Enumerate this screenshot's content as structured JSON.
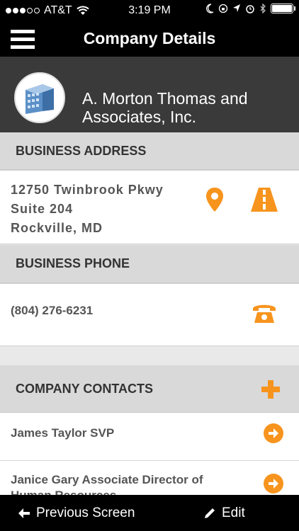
{
  "status_bar": {
    "carrier": "AT&T",
    "time": "3:19 PM"
  },
  "nav": {
    "title": "Company Details"
  },
  "company": {
    "name": "A. Morton Thomas and Associates, Inc."
  },
  "address_section": {
    "heading": "BUSINESS ADDRESS",
    "line1": "12750 Twinbrook Pkwy",
    "line2": "Suite 204",
    "line3": "Rockville, MD"
  },
  "phone_section": {
    "heading": "BUSINESS PHONE",
    "number": "(804) 276-6231"
  },
  "contacts_section": {
    "heading": "COMPANY CONTACTS",
    "contacts": [
      {
        "name": "James Taylor SVP"
      },
      {
        "name": "Janice Gary Associate Director of Human Resources"
      }
    ]
  },
  "bottom_bar": {
    "previous_label": "Previous Screen",
    "edit_label": "Edit"
  },
  "colors": {
    "accent": "#f7941d",
    "navbar": "#000000",
    "header": "#3a3a3a",
    "section": "#d9d9d9"
  }
}
